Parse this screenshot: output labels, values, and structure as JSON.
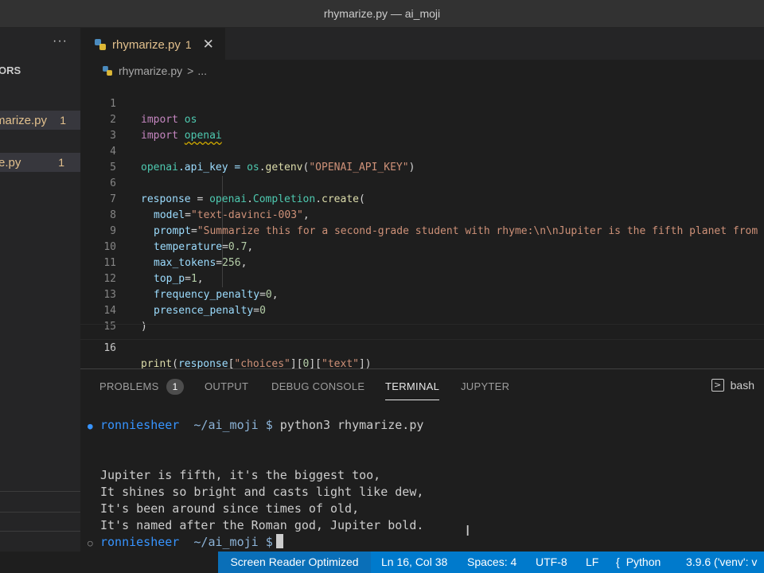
{
  "window": {
    "title": "rhymarize.py — ai_moji"
  },
  "sidebar": {
    "more": "···",
    "open_editors_heading": "ORS",
    "open_editor_item": {
      "name": "marize.py",
      "count": "1"
    },
    "tree_item": {
      "name": "e.py",
      "count": "1"
    }
  },
  "tab": {
    "label": "rhymarize.py",
    "count": "1",
    "close": "✕"
  },
  "breadcrumb": {
    "file": "rhymarize.py",
    "sep": ">",
    "more": "..."
  },
  "editor": {
    "line_numbers": [
      "1",
      "2",
      "3",
      "4",
      "5",
      "6",
      "7",
      "8",
      "9",
      "10",
      "11",
      "12",
      "13",
      "14",
      "15",
      "16"
    ],
    "current_line": "16",
    "code": {
      "l1": [
        "import",
        "os"
      ],
      "l2": [
        "import",
        "openai"
      ],
      "l4": [
        "openai",
        ".api_key = ",
        "os",
        ".",
        "getenv",
        "(",
        "\"OPENAI_API_KEY\"",
        ")"
      ],
      "l6": [
        "response",
        " = ",
        "openai",
        ".",
        "Completion",
        ".",
        "create",
        "("
      ],
      "l7": [
        "model",
        "=",
        "\"text-davinci-003\"",
        ","
      ],
      "l8": [
        "prompt",
        "=",
        "\"Summarize this for a second-grade student with rhyme:\\n\\nJupiter is the fifth planet from"
      ],
      "l9": [
        "temperature",
        "=",
        "0.7",
        ","
      ],
      "l10": [
        "max_tokens",
        "=",
        "256",
        ","
      ],
      "l11": [
        "top_p",
        "=",
        "1",
        ","
      ],
      "l12": [
        "frequency_penalty",
        "=",
        "0",
        ","
      ],
      "l13": [
        "presence_penalty",
        "=",
        "0"
      ],
      "l14": [
        ")"
      ],
      "l16": [
        "print",
        "(",
        "response",
        "[",
        "\"choices\"",
        "][",
        "0",
        "][",
        "\"text\"",
        "])"
      ]
    }
  },
  "panel": {
    "tabs": [
      "PROBLEMS",
      "OUTPUT",
      "DEBUG CONSOLE",
      "TERMINAL",
      "JUPYTER"
    ],
    "problems_count": "1",
    "active_tab": "TERMINAL",
    "shell": "bash",
    "terminal": {
      "user": "ronniesheer",
      "path": "~/ai_moji $",
      "command": "python3 rhymarize.py",
      "output": [
        "Jupiter is fifth, it's the biggest too,",
        "It shines so bright and casts light like dew,",
        "It's been around since times of old,",
        "It's named after the Roman god, Jupiter bold."
      ]
    }
  },
  "status": {
    "screen_reader": "Screen Reader Optimized",
    "position": "Ln 16, Col 38",
    "spaces": "Spaces: 4",
    "encoding": "UTF-8",
    "eol": "LF",
    "language": "Python",
    "interpreter": "3.9.6 ('venv': v"
  },
  "colors": {
    "statusbar": "#007acc",
    "modified_file": "#e2c08d",
    "terminal_user": "#3794ff"
  }
}
